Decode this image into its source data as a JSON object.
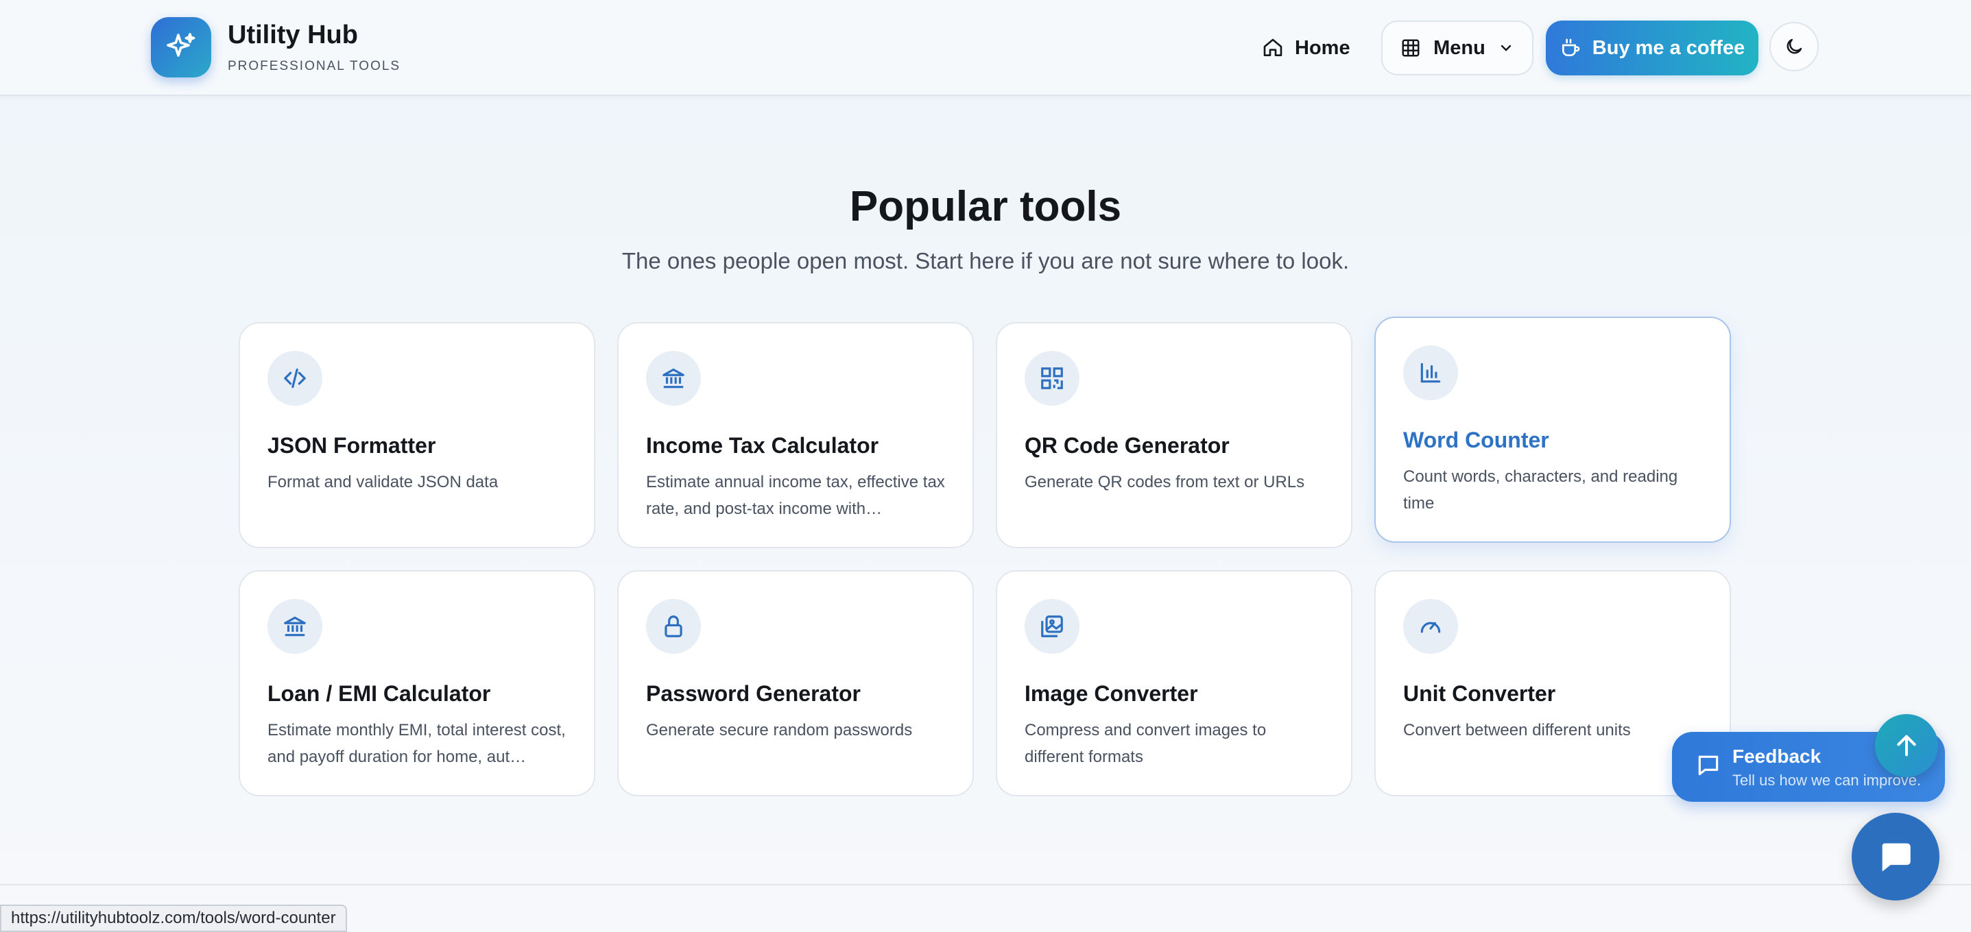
{
  "brand": {
    "title": "Utility Hub",
    "subtitle": "PROFESSIONAL TOOLS",
    "icon": "sparkles-icon"
  },
  "nav": {
    "home_label": "Home",
    "menu_label": "Menu",
    "coffee_label": "Buy me a coffee",
    "theme_icon": "moon-icon"
  },
  "section": {
    "title": "Popular tools",
    "subtitle": "The ones people open most. Start here if you are not sure where to look."
  },
  "tools": [
    {
      "title": "JSON Formatter",
      "desc": "Format and validate JSON data",
      "icon": "code-icon"
    },
    {
      "title": "Income Tax Calculator",
      "desc": "Estimate annual income tax, effective tax rate, and post-tax income with…",
      "icon": "bank-icon"
    },
    {
      "title": "QR Code Generator",
      "desc": "Generate QR codes from text or URLs",
      "icon": "qr-code-icon"
    },
    {
      "title": "Word Counter",
      "desc": "Count words, characters, and reading time",
      "icon": "bar-chart-icon"
    },
    {
      "title": "Loan / EMI Calculator",
      "desc": "Estimate monthly EMI, total interest cost, and payoff duration for home, aut…",
      "icon": "bank-icon"
    },
    {
      "title": "Password Generator",
      "desc": "Generate secure random passwords",
      "icon": "lock-icon"
    },
    {
      "title": "Image Converter",
      "desc": "Compress and convert images to different formats",
      "icon": "image-gallery-icon"
    },
    {
      "title": "Unit Converter",
      "desc": "Convert between different units",
      "icon": "gauge-icon"
    }
  ],
  "feedback": {
    "title": "Feedback",
    "subtitle": "Tell us how we can improve."
  },
  "status_bar": {
    "url": "https://utilityhubtoolz.com/tools/word-counter"
  },
  "colors": {
    "accent": "#2f79da",
    "accent_teal": "#22b4c4",
    "icon_blue": "#2d6fc0"
  }
}
